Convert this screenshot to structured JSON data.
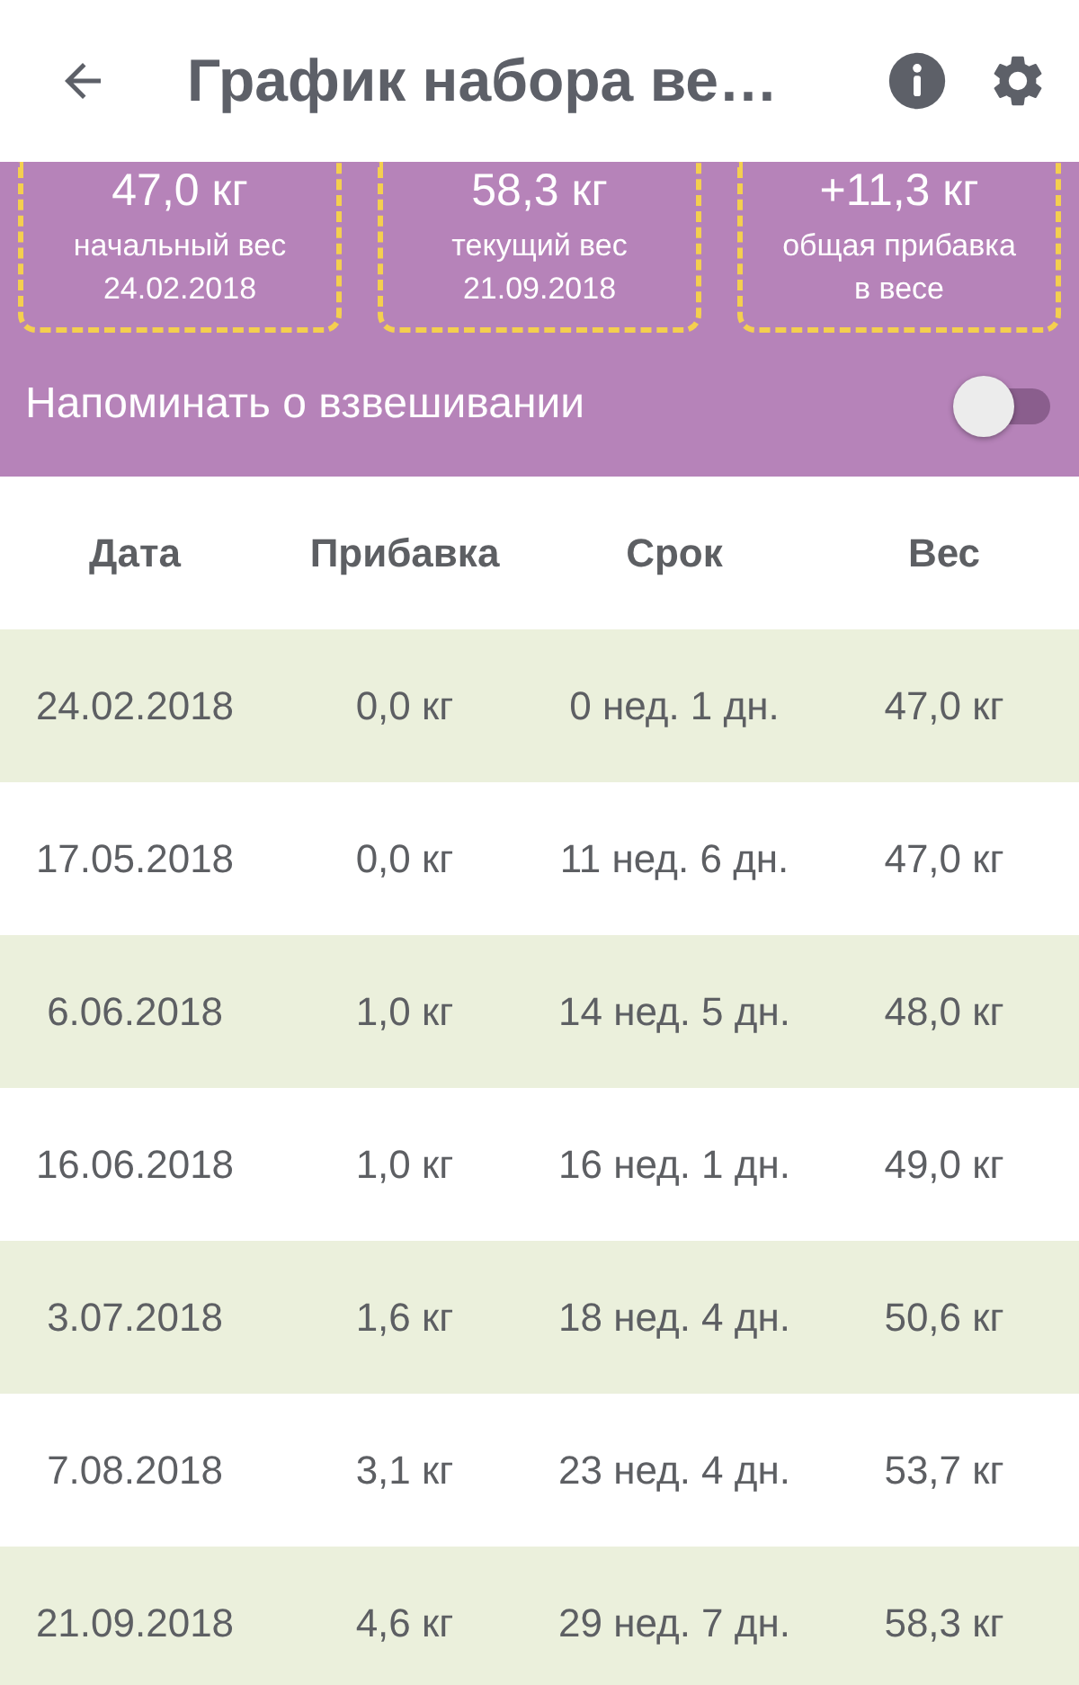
{
  "app_bar": {
    "title": "График набора ве…"
  },
  "summary": [
    {
      "value": "47,0 кг",
      "label": "начальный вес",
      "sub": "24.02.2018"
    },
    {
      "value": "58,3 кг",
      "label": "текущий вес",
      "sub": "21.09.2018"
    },
    {
      "value": "+11,3 кг",
      "label": "общая прибавка",
      "sub": "в весе"
    }
  ],
  "reminder": {
    "label": "Напоминать о взвешивании",
    "on": false
  },
  "table": {
    "columns": [
      "Дата",
      "Прибавка",
      "Срок",
      "Вес"
    ],
    "rows": [
      [
        "24.02.2018",
        "0,0 кг",
        "0 нед. 1 дн.",
        "47,0 кг"
      ],
      [
        "17.05.2018",
        "0,0 кг",
        "11 нед. 6 дн.",
        "47,0 кг"
      ],
      [
        "6.06.2018",
        "1,0 кг",
        "14 нед. 5 дн.",
        "48,0 кг"
      ],
      [
        "16.06.2018",
        "1,0 кг",
        "16 нед. 1 дн.",
        "49,0 кг"
      ],
      [
        "3.07.2018",
        "1,6 кг",
        "18 нед. 4 дн.",
        "50,6 кг"
      ],
      [
        "7.08.2018",
        "3,1 кг",
        "23 нед. 4 дн.",
        "53,7 кг"
      ],
      [
        "21.09.2018",
        "4,6 кг",
        "29 нед. 7 дн.",
        "58,3 кг"
      ]
    ]
  }
}
